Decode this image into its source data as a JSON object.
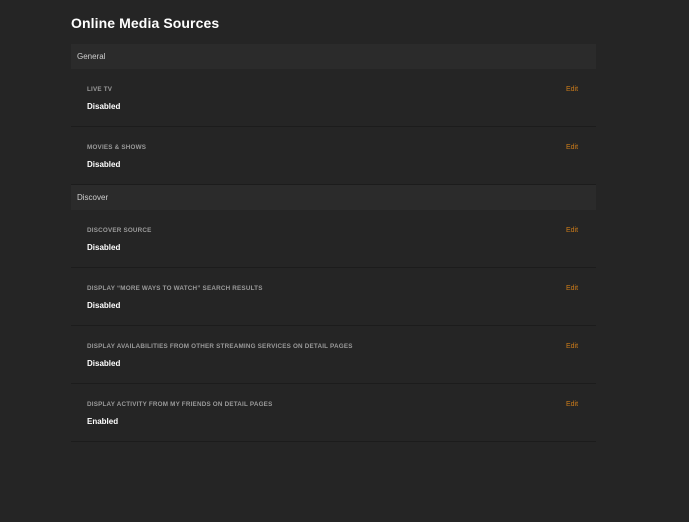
{
  "page": {
    "title": "Online Media Sources"
  },
  "colors": {
    "background": "#252525",
    "section_header_bg": "#2b2b2b",
    "accent": "#cc7b19"
  },
  "sections": [
    {
      "title": "General",
      "items": [
        {
          "label": "LIVE TV",
          "value": "Disabled",
          "action": "Edit"
        },
        {
          "label": "MOVIES & SHOWS",
          "value": "Disabled",
          "action": "Edit"
        }
      ]
    },
    {
      "title": "Discover",
      "items": [
        {
          "label": "DISCOVER SOURCE",
          "value": "Disabled",
          "action": "Edit"
        },
        {
          "label": "DISPLAY “MORE WAYS TO WATCH” SEARCH RESULTS",
          "value": "Disabled",
          "action": "Edit"
        },
        {
          "label": "DISPLAY AVAILABILITIES FROM OTHER STREAMING SERVICES ON DETAIL PAGES",
          "value": "Disabled",
          "action": "Edit"
        },
        {
          "label": "DISPLAY ACTIVITY FROM MY FRIENDS ON DETAIL PAGES",
          "value": "Enabled",
          "action": "Edit"
        }
      ]
    }
  ]
}
